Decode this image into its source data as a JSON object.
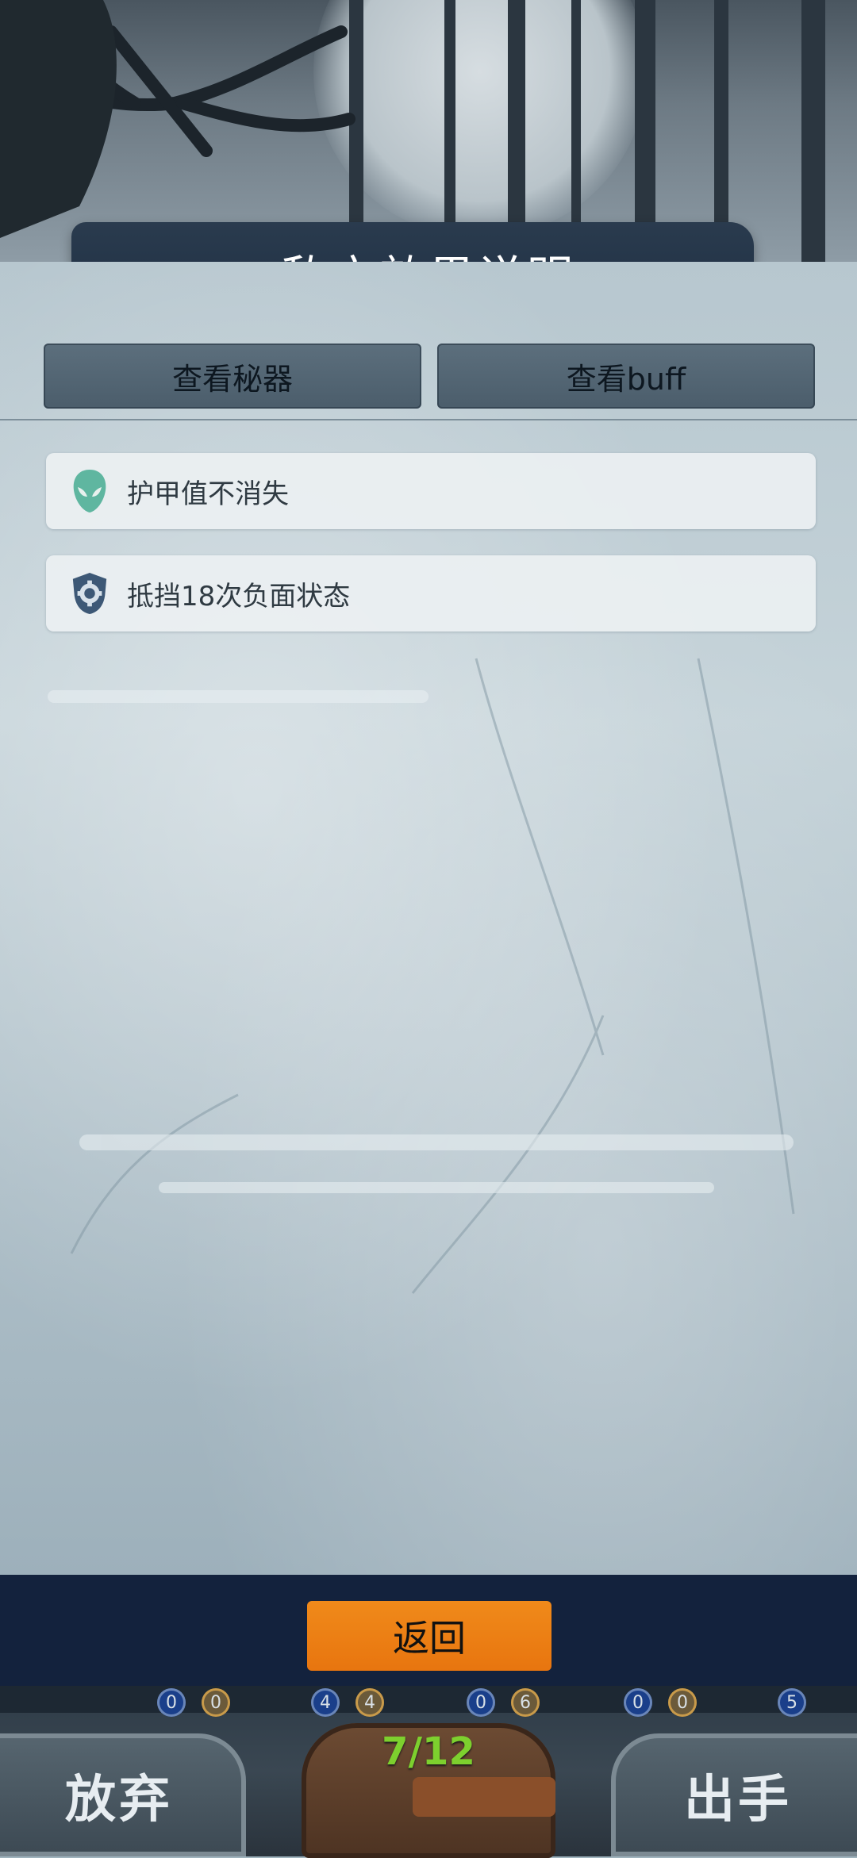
{
  "header": {
    "title": "敌方效果说明"
  },
  "tabs": [
    {
      "label": "查看秘器"
    },
    {
      "label": "查看buff"
    }
  ],
  "effects": [
    {
      "icon": "alien-mask-icon",
      "label": "护甲值不消失"
    },
    {
      "icon": "shield-gear-icon",
      "label": "抵挡18次负面状态"
    }
  ],
  "footer": {
    "back_label": "返回"
  },
  "game_bar": {
    "abandon_label": "放弃",
    "play_label": "出手",
    "card_count": "7/12",
    "stat_values": [
      "0",
      "0",
      "4",
      "4",
      "0",
      "6",
      "0",
      "0",
      "5"
    ]
  },
  "colors": {
    "back_button": "#e8750f",
    "card_count": "#7dd02e",
    "bottom_bar": "#13223d"
  }
}
